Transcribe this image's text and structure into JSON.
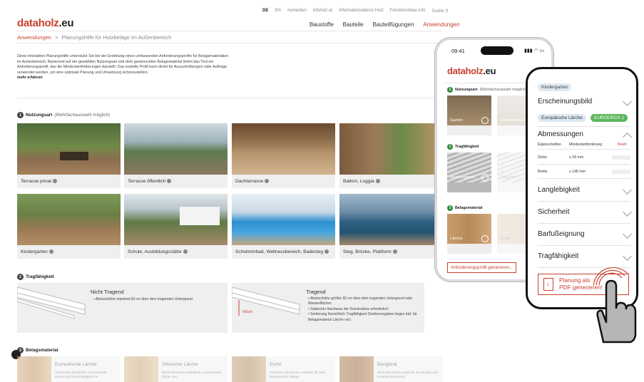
{
  "topnav": {
    "lang_de": "DE",
    "lang_en": "EN",
    "items": [
      "Anmelden",
      "infoholz.at",
      "Informationsdienst Holz",
      "Fensterinnbau.info",
      "Suche"
    ]
  },
  "logo": {
    "part1": "dataholz",
    "part2": ".eu"
  },
  "mainnav": [
    "Baustoffe",
    "Bauteile",
    "Bauteilfügungen",
    "Anwendungen"
  ],
  "breadcrumb": {
    "root": "Anwendungen",
    "sep": ">",
    "current": "Planungshilfe für Holzbeläge im Außenbereich"
  },
  "intro": {
    "text": "Diese interaktive Planungshilfe unterstützt Sie bei der Erstellung eines umfassenden Anforderungsprofils für Belagsmaterialien im Außenbereich. Basierend auf der gewählten Nutzungsart und dem gewünschten Belagsmaterial liefert das Tool ein Anforderungsprofil, das die Mindestanforderungen darstellt. Das erstellte Profil kann direkt für Ausschreibungen oder Aufträge verwendet werden, um eine optimale Planung und Umsetzung sicherzustellen.",
    "more": "mehr erfahren"
  },
  "section1": {
    "num": "1",
    "title": "Nutzungsart",
    "sub": "(Mehrfachauswahl möglich)"
  },
  "usage_cards": [
    "Terrasse privat",
    "Terrasse öffentlich",
    "Dachterrasse",
    "Balkon, Loggia",
    "Kindergarten",
    "Schule, Ausbildungsstätte",
    "Schwimmbad, Wellnessbereich, Badesteg",
    "Steg, Brücke, Plattform"
  ],
  "section2": {
    "num": "2",
    "title": "Tragfähigkeit"
  },
  "load_cards": [
    {
      "title": "Nicht Tragend",
      "bullets": [
        "Absturzhöhe maximal 60 cm über dem tragenden Untergrund"
      ]
    },
    {
      "title": "Tragend",
      "bullets": [
        "Absturzhöhe größer 60 cm über dem tragenden Untergrund oder Wasserflächen",
        "Statischer Nachweis der Konstruktion erforderlich",
        "Sortierung hinsichtlich Tragfähigkeit (Sortiervorgaben liegen bisl. für Belagsmaterial Lärche vor)"
      ],
      "dim": ">60cm"
    }
  ],
  "section3": {
    "num": "3",
    "title": "Belagsmaterial"
  },
  "materials": [
    {
      "name": "Europäische Lärche",
      "desc": "Heimisches Nadelholz: Ausreichende Dichte und Dauerhaftigkeit. Für"
    },
    {
      "name": "Sibirische Lärche",
      "desc": "Nicht heimisches Nadelholz: Ausreichende Dichte und"
    },
    {
      "name": "Eiche",
      "desc": "Schweres heimisches Laubholz für stark beanspruchte Beläge"
    },
    {
      "name": "Bangkirai",
      "desc": "Nicht heimisches Laubholz: Für Beläge und Unterkonstruktionen"
    }
  ],
  "phone": {
    "time": "09:41",
    "s1": "Nutzungsart",
    "s1sub": "(Mehrfachauswahl möglich)",
    "c1": "Garten",
    "c2": "Dachterrasse",
    "s2": "Tragfähigkeit",
    "c3": "Nicht tragend",
    "c4": "Tragend",
    "s3": "Belagsmaterial",
    "c5": "Lärche",
    "c6": "Eiche",
    "button": "Anforderungsprofil generieren..."
  },
  "panel": {
    "tag": "Kindergarten",
    "appearance": "Erscheinungsbild",
    "tag_wood": "Europäische Lärche",
    "tag_product": "EURODECK 1",
    "dimensions": "Abmessungen",
    "th": [
      "Eigenschaften",
      "Mindestanforderung",
      "Bewh"
    ],
    "rows": [
      {
        "k": "Dicke",
        "v": "≥ 24 mm"
      },
      {
        "k": "Breite",
        "v": "≤ 145 mm"
      }
    ],
    "more": [
      "Langlebigkeit",
      "Sicherheit",
      "Barfußeignung",
      "Tragfähigkeit"
    ],
    "pdf": [
      "Planung als",
      "PDF generieren!"
    ]
  },
  "colors": {
    "brand": "#c8412f",
    "green": "#5cb85c"
  }
}
